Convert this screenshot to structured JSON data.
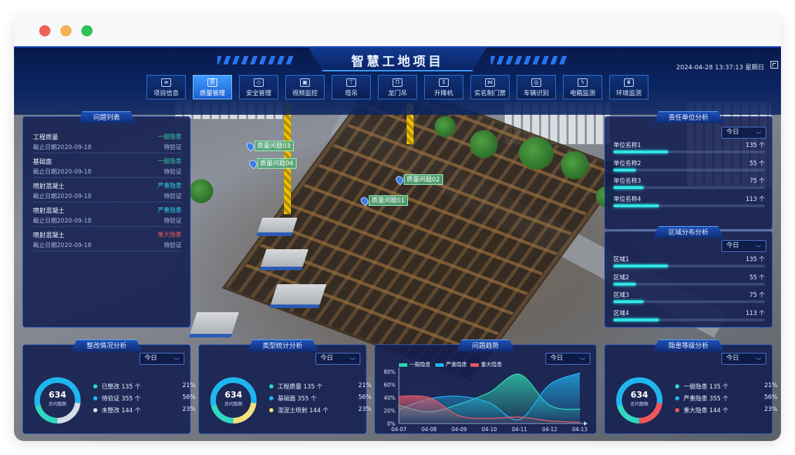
{
  "window": {
    "controls": [
      "close",
      "minimize",
      "maximize"
    ]
  },
  "header": {
    "title": "智慧工地项目",
    "datetime": "2024-04-28 13:37:13 星期日"
  },
  "nav": [
    {
      "label": "项目信息",
      "icon": "document-icon",
      "active": false
    },
    {
      "label": "质量管理",
      "icon": "quality-shield-icon",
      "active": true
    },
    {
      "label": "安全管理",
      "icon": "safety-shield-icon",
      "active": false
    },
    {
      "label": "视频监控",
      "icon": "camera-icon",
      "active": false
    },
    {
      "label": "塔吊",
      "icon": "tower-crane-icon",
      "active": false
    },
    {
      "label": "龙门吊",
      "icon": "gantry-crane-icon",
      "active": false
    },
    {
      "label": "升降机",
      "icon": "elevator-icon",
      "active": false
    },
    {
      "label": "实名制门禁",
      "icon": "gate-icon",
      "active": false
    },
    {
      "label": "车辆识别",
      "icon": "vehicle-icon",
      "active": false
    },
    {
      "label": "电箱监测",
      "icon": "electric-box-icon",
      "active": false
    },
    {
      "label": "环境监测",
      "icon": "leaf-icon",
      "active": false
    }
  ],
  "markers": [
    "质量问题03",
    "质量问题04",
    "质量问题02",
    "质量问题01"
  ],
  "issue_list": {
    "title": "问题列表",
    "items": [
      {
        "name": "工程质量",
        "date": "截止日期2020-09-18",
        "level": "一般隐患",
        "level_color": "#35c9a8",
        "status": "待验证"
      },
      {
        "name": "基础面",
        "date": "截止日期2020-09-18",
        "level": "一般隐患",
        "level_color": "#35c9a8",
        "status": "待验证"
      },
      {
        "name": "喷射混凝土",
        "date": "截止日期2020-09-18",
        "level": "严重隐患",
        "level_color": "#2fd0e6",
        "status": "待验证"
      },
      {
        "name": "喷射混凝土",
        "date": "截止日期2020-09-18",
        "level": "严重隐患",
        "level_color": "#2fd0e6",
        "status": "待验证"
      },
      {
        "name": "喷射混凝土",
        "date": "截止日期2020-09-18",
        "level": "重大隐患",
        "level_color": "#f0575a",
        "status": "待验证"
      }
    ]
  },
  "responsible_unit": {
    "title": "责任单位分析",
    "period": "今日",
    "rows": [
      {
        "label": "单位名称1",
        "value": "135 个",
        "fraction": 0.36
      },
      {
        "label": "单位名称2",
        "value": "55 个",
        "fraction": 0.15
      },
      {
        "label": "单位名称3",
        "value": "75 个",
        "fraction": 0.2
      },
      {
        "label": "单位名称4",
        "value": "113 个",
        "fraction": 0.3
      }
    ]
  },
  "area_distribution": {
    "title": "区域分布分析",
    "period": "今日",
    "rows": [
      {
        "label": "区域1",
        "value": "135 个",
        "fraction": 0.36
      },
      {
        "label": "区域2",
        "value": "55 个",
        "fraction": 0.15
      },
      {
        "label": "区域3",
        "value": "75 个",
        "fraction": 0.2
      },
      {
        "label": "区域4",
        "value": "113 个",
        "fraction": 0.3
      }
    ]
  },
  "rectification": {
    "title": "整改情况分析",
    "period": "今日",
    "total": "634",
    "total_label": "总问题数",
    "items": [
      {
        "label": "已整改 135 个",
        "pct": "21%",
        "color": "#2fd8c0",
        "fraction": 0.21
      },
      {
        "label": "待验证 355 个",
        "pct": "56%",
        "color": "#1fb6f0",
        "fraction": 0.56
      },
      {
        "label": "未整改 144 个",
        "pct": "23%",
        "color": "#d7dde8",
        "fraction": 0.23
      }
    ]
  },
  "type_stats": {
    "title": "类型统计分析",
    "period": "今日",
    "total": "634",
    "total_label": "总问题数",
    "items": [
      {
        "label": "工程质量 135 个",
        "pct": "21%",
        "color": "#2fd8c0",
        "fraction": 0.21
      },
      {
        "label": "基础面 355 个",
        "pct": "56%",
        "color": "#1fb6f0",
        "fraction": 0.56
      },
      {
        "label": "混泥土喷射 144 个",
        "pct": "23%",
        "color": "#f4e27a",
        "fraction": 0.23
      }
    ]
  },
  "hazard_level": {
    "title": "隐患等级分析",
    "period": "今日",
    "total": "634",
    "total_label": "总问题数",
    "items": [
      {
        "label": "一般隐患 135 个",
        "pct": "21%",
        "color": "#2fd8c0",
        "fraction": 0.21
      },
      {
        "label": "严重隐患 355 个",
        "pct": "56%",
        "color": "#1fb6f0",
        "fraction": 0.56
      },
      {
        "label": "重大隐患 144 个",
        "pct": "23%",
        "color": "#f0575a",
        "fraction": 0.23
      }
    ]
  },
  "trend": {
    "title": "问题趋势",
    "period": "今日"
  },
  "chart_data": {
    "type": "area",
    "categories": [
      "04-07",
      "04-08",
      "04-09",
      "04-10",
      "04-11",
      "04-12",
      "04-13"
    ],
    "ylim": [
      0,
      80
    ],
    "yticks": [
      "0%",
      "20%",
      "40%",
      "60%",
      "80%"
    ],
    "series": [
      {
        "name": "一般隐患",
        "color": "#2fd8b0",
        "values": [
          28,
          18,
          30,
          48,
          76,
          28,
          22
        ]
      },
      {
        "name": "严重隐患",
        "color": "#1fb6f0",
        "values": [
          22,
          38,
          42,
          32,
          6,
          60,
          78
        ]
      },
      {
        "name": "重大隐患",
        "color": "#e35a6a",
        "values": [
          42,
          40,
          12,
          8,
          10,
          4,
          2
        ]
      }
    ]
  }
}
